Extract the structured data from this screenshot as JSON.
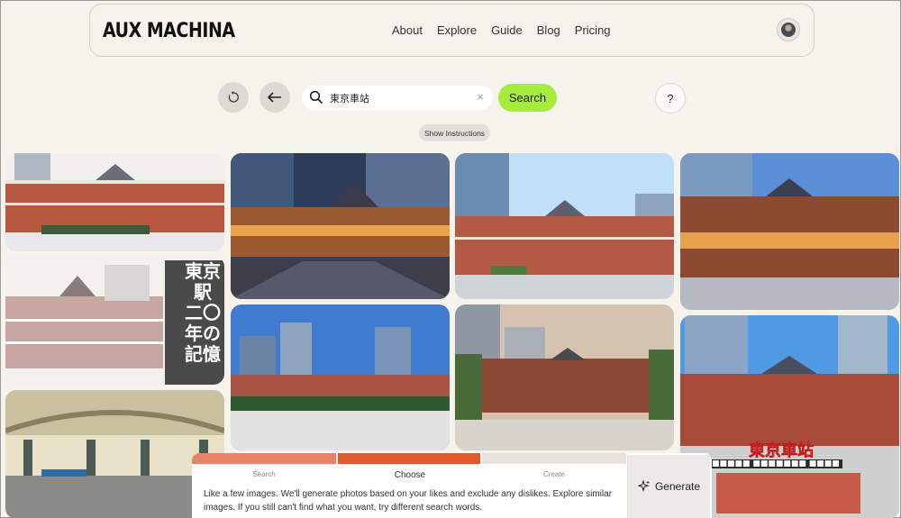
{
  "header": {
    "logo": "AUX MACHINA",
    "nav": [
      "About",
      "Explore",
      "Guide",
      "Blog",
      "Pricing"
    ]
  },
  "toolbar": {
    "search_value": "東京車站",
    "search_button": "Search",
    "help_label": "?",
    "instructions_button": "Show Instructions"
  },
  "gallery": {
    "overlay_vertical": [
      "東京駅",
      "二〇年の",
      "記憶"
    ],
    "overlay_title": "東京車站",
    "overlay_caption": "■■■■■ ■■■■■■■ ■■■■"
  },
  "panel": {
    "steps": [
      "Search",
      "Choose",
      "Create"
    ],
    "active_step": "Choose",
    "description": "Like a few images. We'll generate photos based on your likes and exclude any dislikes. Explore similar images. If you still can't find what you want, try different search words.",
    "generate_label": "Generate"
  },
  "colors": {
    "search_green": "#a6ec3c",
    "progress_done": "#e8836a",
    "progress_active": "#e05a2b",
    "progress_todo": "#e8e3dc"
  }
}
